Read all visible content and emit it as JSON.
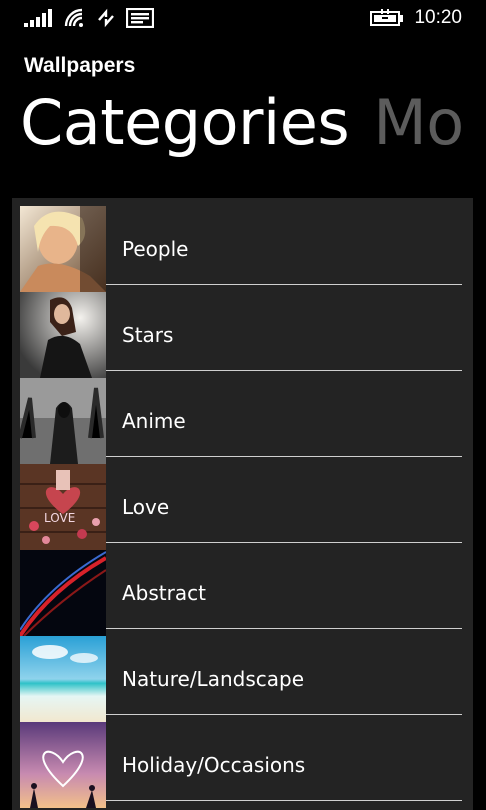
{
  "status_bar": {
    "time": "10:20",
    "icons": [
      "signal-icon",
      "wifi-icon",
      "data-transfer-icon",
      "message-icon",
      "battery-charging-icon"
    ]
  },
  "app": {
    "title": "Wallpapers"
  },
  "pivot": {
    "active": "Categories",
    "next": "Mo"
  },
  "categories": [
    {
      "label": "People"
    },
    {
      "label": "Stars"
    },
    {
      "label": "Anime"
    },
    {
      "label": "Love"
    },
    {
      "label": "Abstract"
    },
    {
      "label": "Nature/Landscape"
    },
    {
      "label": "Holiday/Occasions"
    }
  ]
}
